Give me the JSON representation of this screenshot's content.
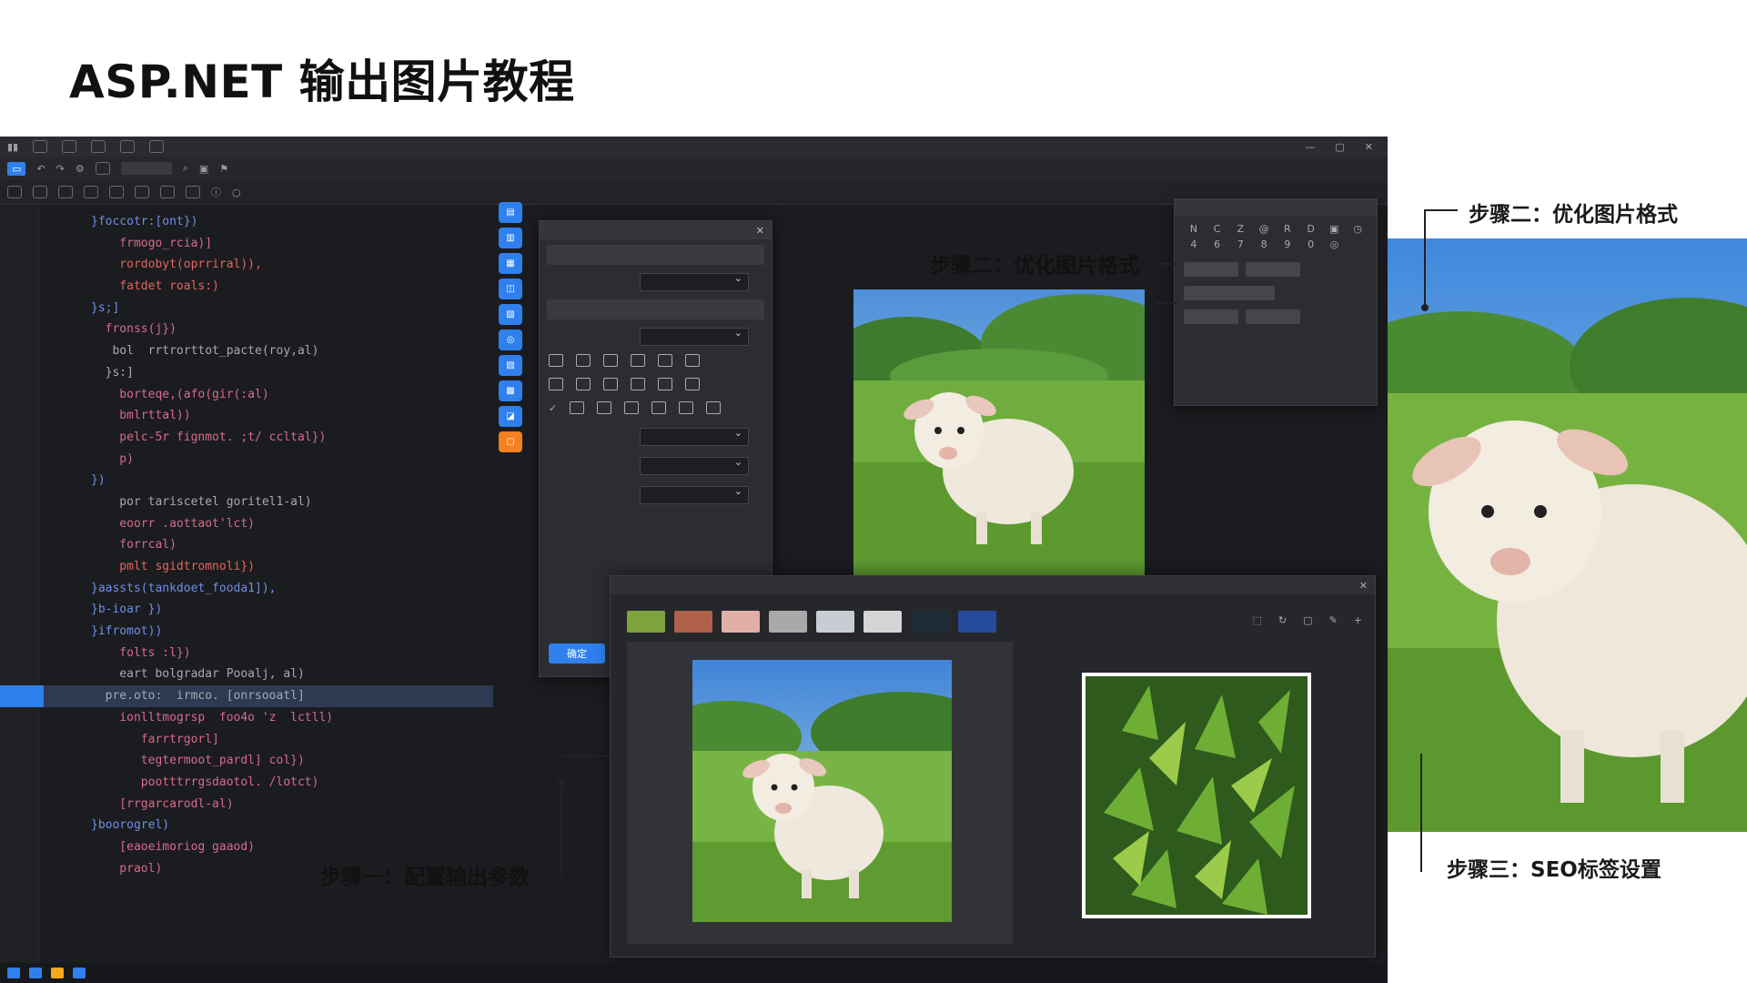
{
  "page_title": "ASP.NET 输出图片教程",
  "callouts": {
    "step1": "步骤一：配置输出参数",
    "step2_center": "步骤二：优化图片格式",
    "step2_right": "步骤二：优化图片格式",
    "step3": "步骤三：SEO标签设置"
  },
  "ide": {
    "properties_panel": {
      "confirm_button": "确定"
    }
  },
  "colors": {
    "accent": "#2f80ed",
    "orange": "#f4801f",
    "ide_background": "#1b1c1f"
  },
  "icons": [
    "app-icon",
    "save-icon",
    "close-icon",
    "minimize-icon",
    "maximize-icon",
    "lamb-image",
    "plant-image"
  ]
}
